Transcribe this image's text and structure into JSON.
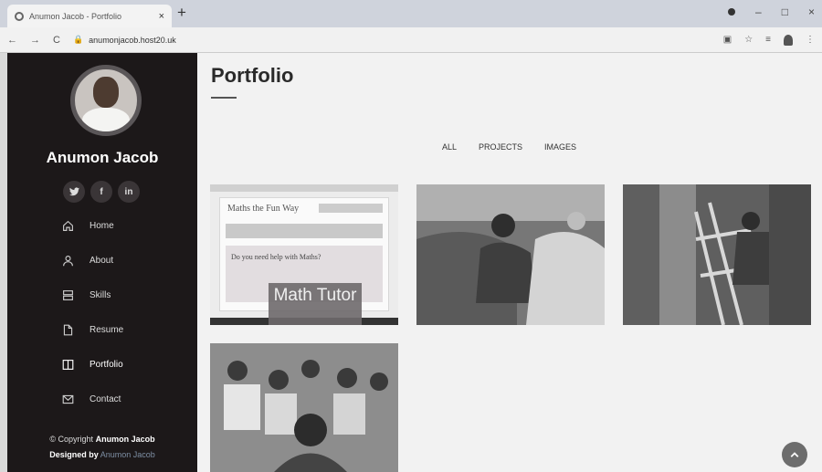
{
  "browser": {
    "tab_title": "Anumon Jacob - Portfolio",
    "tab_close": "×",
    "new_tab": "+",
    "url": "anumonjacob.host20.uk",
    "back": "←",
    "forward": "→",
    "reload": "C",
    "minimize": "–",
    "maximize": "□",
    "close": "×"
  },
  "sidebar": {
    "name": "Anumon Jacob",
    "social": [
      {
        "label": "🐦",
        "icon": "twitter-icon"
      },
      {
        "label": "f",
        "icon": "facebook-icon"
      },
      {
        "label": "in",
        "icon": "linkedin-icon"
      }
    ],
    "menu": [
      {
        "label": "Home",
        "icon": "home-icon"
      },
      {
        "label": "About",
        "icon": "user-icon"
      },
      {
        "label": "Skills",
        "icon": "server-icon"
      },
      {
        "label": "Resume",
        "icon": "file-icon"
      },
      {
        "label": "Portfolio",
        "icon": "book-icon",
        "active": true
      },
      {
        "label": "Contact",
        "icon": "envelope-icon"
      }
    ],
    "footer": {
      "copyright_prefix": "© Copyright",
      "copyright_name": "Anumon Jacob",
      "designed_prefix": "Designed by",
      "designed_name": "Anumon Jacob"
    }
  },
  "main": {
    "title": "Portfolio",
    "filters": [
      "ALL",
      "PROJECTS",
      "IMAGES"
    ],
    "items": [
      {
        "overlay_title": "Math Tutor",
        "site_title": "Maths the Fun Way",
        "site_text": "Do you need help with Maths?"
      }
    ]
  },
  "colors": {
    "sidebar_bg": "#1c1819",
    "page_bg": "#f2f2f2",
    "muted_accent": "#7d8ea3"
  }
}
